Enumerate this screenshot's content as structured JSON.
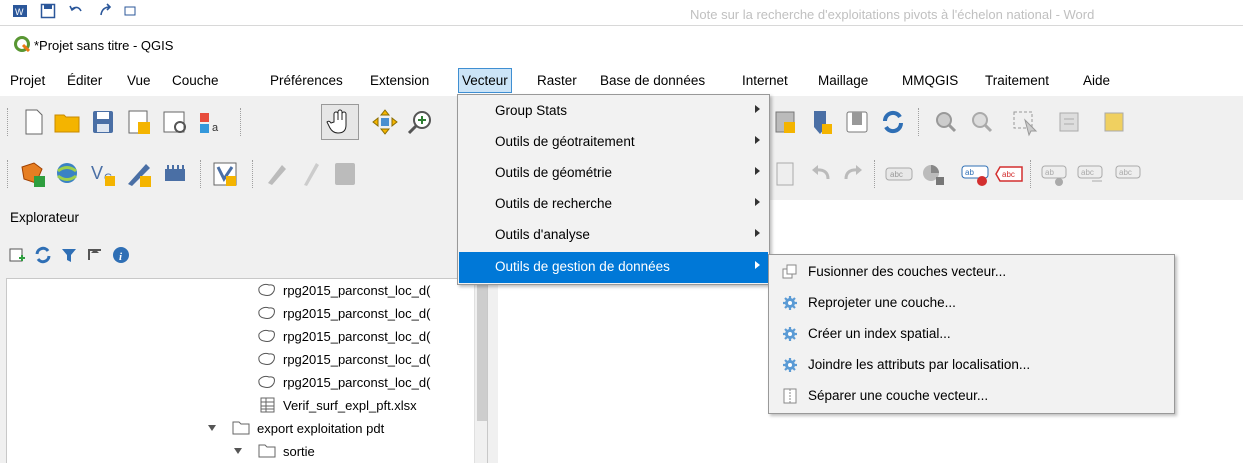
{
  "word_window_title": "Note sur la recherche d'exploitations pivots à l'échelon national - Word",
  "window_title": "*Projet sans titre - QGIS",
  "menubar": [
    {
      "label": "Projet"
    },
    {
      "label": "Éditer"
    },
    {
      "label": "Vue"
    },
    {
      "label": "Couche"
    },
    {
      "label": "Préférences"
    },
    {
      "label": "Extension"
    },
    {
      "label": "Vecteur"
    },
    {
      "label": "Raster"
    },
    {
      "label": "Base de données"
    },
    {
      "label": "Internet"
    },
    {
      "label": "Maillage"
    },
    {
      "label": "MMQGIS"
    },
    {
      "label": "Traitement"
    },
    {
      "label": "Aide"
    }
  ],
  "vector_menu": {
    "items": [
      {
        "label": "Group Stats"
      },
      {
        "label": "Outils de géotraitement"
      },
      {
        "label": "Outils de géométrie"
      },
      {
        "label": "Outils de recherche"
      },
      {
        "label": "Outils d'analyse"
      },
      {
        "label": "Outils de gestion de données"
      }
    ],
    "highlighted": "Outils de gestion de données"
  },
  "data_management_submenu": {
    "items": [
      {
        "label": "Fusionner des couches vecteur...",
        "icon": "merge-layers-icon"
      },
      {
        "label": "Reprojeter une couche...",
        "icon": "gear-icon"
      },
      {
        "label": "Créer un index spatial...",
        "icon": "gear-icon"
      },
      {
        "label": "Joindre les attributs par localisation...",
        "icon": "gear-icon"
      },
      {
        "label": "Séparer une couche vecteur...",
        "icon": "split-layer-icon"
      }
    ]
  },
  "explorer": {
    "title": "Explorateur",
    "tree": [
      {
        "label": "rpg2015_parconst_loc_d(",
        "icon": "polygon-layer-icon"
      },
      {
        "label": "rpg2015_parconst_loc_d(",
        "icon": "polygon-layer-icon"
      },
      {
        "label": "rpg2015_parconst_loc_d(",
        "icon": "polygon-layer-icon"
      },
      {
        "label": "rpg2015_parconst_loc_d(",
        "icon": "polygon-layer-icon"
      },
      {
        "label": "rpg2015_parconst_loc_d(",
        "icon": "polygon-layer-icon"
      },
      {
        "label": "Verif_surf_expl_pft.xlsx",
        "icon": "table-icon"
      },
      {
        "label": "export exploitation pdt",
        "icon": "folder-icon"
      },
      {
        "label": "sortie",
        "icon": "folder-icon"
      }
    ]
  },
  "colors": {
    "menu_highlight": "#0078d7",
    "menu_active_bg": "#cce4f7",
    "qgis_green": "#589632"
  }
}
